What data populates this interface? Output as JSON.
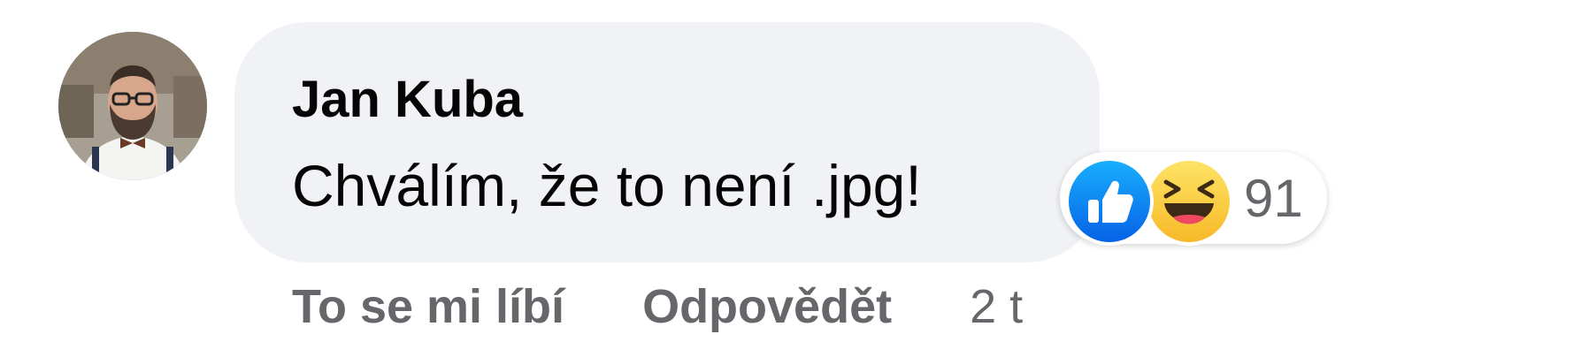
{
  "comment": {
    "author": "Jan Kuba",
    "text": "Chválím, že to není .jpg!",
    "avatar_icon": "profile-photo"
  },
  "reactions": {
    "types": [
      "like",
      "haha"
    ],
    "count": "91",
    "colors": {
      "like": "#1877f2",
      "haha": "#f7b928"
    }
  },
  "actions": {
    "like_label": "To se mi líbí",
    "reply_label": "Odpovědět",
    "timestamp": "2 t"
  },
  "colors": {
    "bubble": "#f0f2f5",
    "text": "#050505",
    "muted": "#65676b"
  }
}
